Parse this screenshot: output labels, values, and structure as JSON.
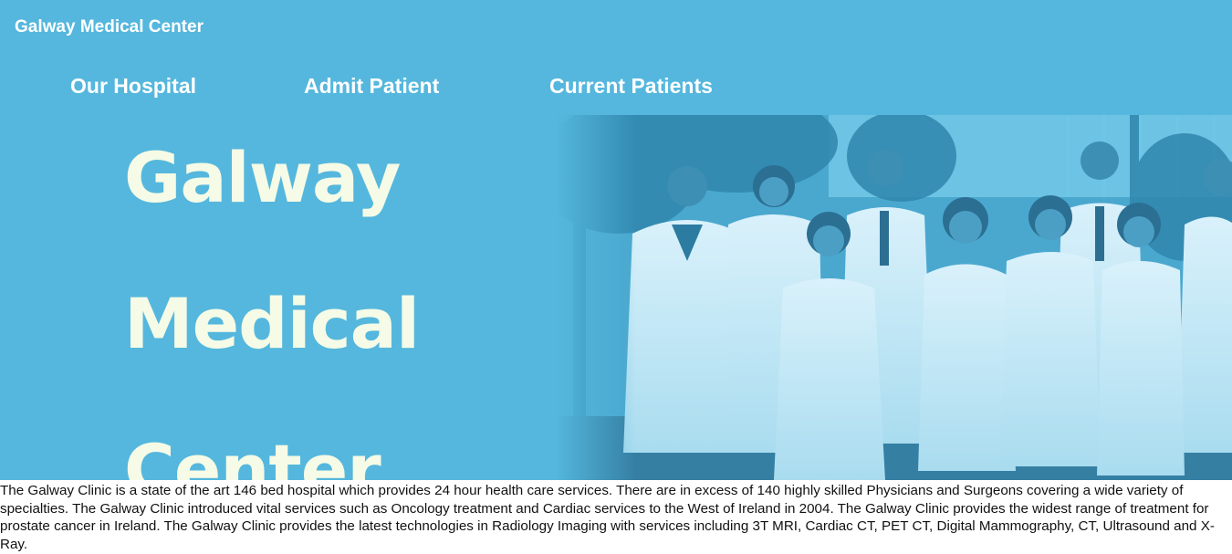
{
  "header": {
    "brand": "Galway Medical Center"
  },
  "nav": {
    "items": [
      "Our Hospital",
      "Admit Patient",
      "Current Patients"
    ]
  },
  "hero": {
    "headline_lines": [
      "Galway",
      "Medical",
      "Center"
    ],
    "photo": "doctors-group-photo",
    "colors": {
      "banner": "#55b7dd",
      "headline": "#f5fbe6",
      "nav_text": "#ffffff"
    }
  },
  "main": {
    "description": "The Galway Clinic is a state of the art 146 bed hospital which provides 24 hour health care services. There are in excess of 140 highly skilled Physicians and Surgeons covering a wide variety of specialties. The Galway Clinic introduced vital services such as Oncology treatment and Cardiac services to the West of Ireland in 2004. The Galway Clinic provides the widest range of treatment for prostate cancer in Ireland. The Galway Clinic provides the latest technologies in Radiology Imaging with services including 3T MRI, Cardiac CT, PET CT, Digital Mammography, CT, Ultrasound and X-Ray."
  }
}
